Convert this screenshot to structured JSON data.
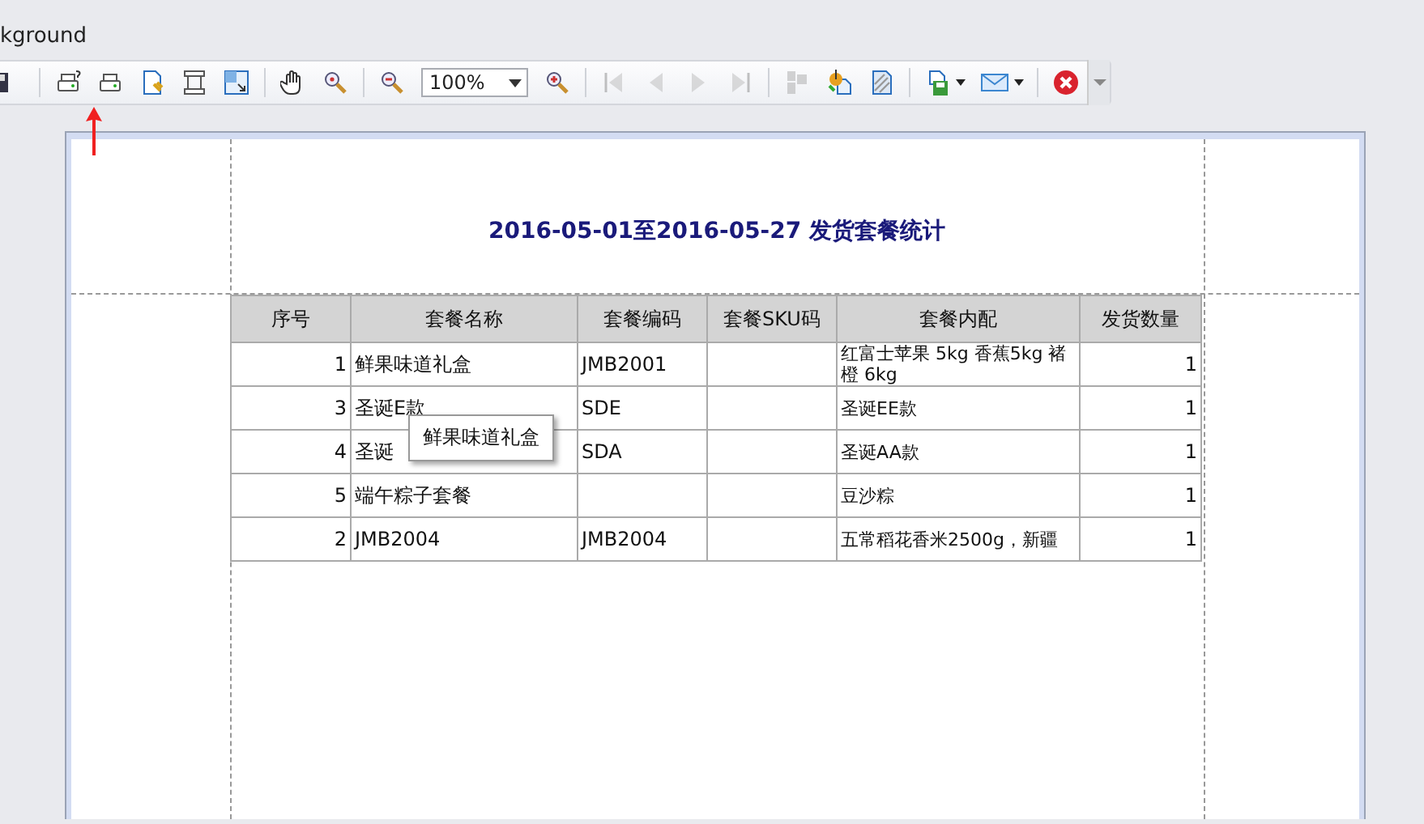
{
  "window": {
    "title": "kground"
  },
  "toolbar": {
    "zoom": "100%",
    "groups": [
      [
        {
          "kind": "save",
          "disabled": false
        }
      ],
      [
        {
          "kind": "print-preview",
          "disabled": false
        },
        {
          "kind": "print",
          "disabled": false
        },
        {
          "kind": "page-setup",
          "disabled": false
        },
        {
          "kind": "resize",
          "disabled": false
        },
        {
          "kind": "fit",
          "disabled": false
        }
      ],
      [
        {
          "kind": "hand",
          "disabled": false
        },
        {
          "kind": "zoom-tool",
          "disabled": false
        }
      ],
      [
        {
          "kind": "zoom-out",
          "disabled": false
        },
        {
          "kind": "zoom-combo",
          "disabled": false
        },
        {
          "kind": "zoom-in",
          "disabled": false
        }
      ],
      [
        {
          "kind": "first",
          "disabled": true
        },
        {
          "kind": "prev",
          "disabled": true
        },
        {
          "kind": "next",
          "disabled": true
        },
        {
          "kind": "last",
          "disabled": true
        }
      ],
      [
        {
          "kind": "multipage",
          "disabled": true
        },
        {
          "kind": "paint",
          "disabled": false
        },
        {
          "kind": "watermark",
          "disabled": false
        }
      ],
      [
        {
          "kind": "export",
          "disabled": false
        },
        {
          "kind": "email",
          "disabled": false
        }
      ],
      [
        {
          "kind": "close",
          "disabled": false
        }
      ]
    ]
  },
  "report": {
    "title": "2016-05-01至2016-05-27 发货套餐统计",
    "columns": [
      "序号",
      "套餐名称",
      "套餐编码",
      "套餐SKU码",
      "套餐内配",
      "发货数量"
    ],
    "rows": [
      [
        "1",
        "鲜果味道礼盒",
        "JMB2001",
        "",
        "红富士苹果 5kg  香蕉5kg 褚橙 6kg",
        "1"
      ],
      [
        "3",
        "圣诞E款",
        "SDE",
        "",
        "圣诞EE款",
        "1"
      ],
      [
        "4",
        "圣诞",
        "SDA",
        "",
        "圣诞AA款",
        "1"
      ],
      [
        "5",
        "端午粽子套餐",
        "",
        "",
        "豆沙粽",
        "1"
      ],
      [
        "2",
        "JMB2004",
        "JMB2004",
        "",
        "五常稻花香米2500g，新疆",
        "1"
      ]
    ],
    "tooltip": "鲜果味道礼盒"
  }
}
